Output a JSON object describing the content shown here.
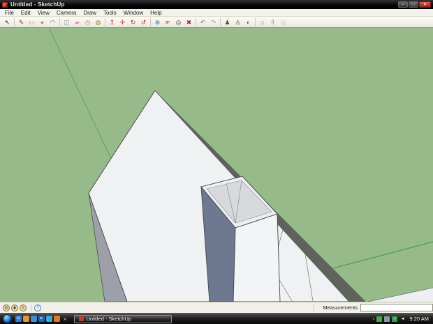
{
  "window": {
    "title": "Untitled - SketchUp",
    "controls": {
      "minimize": "–",
      "maximize": "▢",
      "close": "✕"
    }
  },
  "menu": {
    "items": [
      "File",
      "Edit",
      "View",
      "Camera",
      "Draw",
      "Tools",
      "Window",
      "Help"
    ]
  },
  "toolbar": {
    "groups": [
      [
        {
          "name": "select-tool",
          "glyph": "↖",
          "color": "#1a1a1a"
        }
      ],
      [
        {
          "name": "line-tool",
          "glyph": "✎",
          "color": "#a23228"
        },
        {
          "name": "rectangle-tool",
          "glyph": "▭",
          "color": "#a8905a"
        },
        {
          "name": "circle-tool",
          "glyph": "●",
          "color": "#b49a62"
        },
        {
          "name": "arc-tool",
          "glyph": "◠",
          "color": "#5a5a5a"
        }
      ],
      [
        {
          "name": "make-component-tool",
          "glyph": "◫",
          "color": "#9aa0a8"
        },
        {
          "name": "eraser-tool",
          "glyph": "▰",
          "color": "#d897ae"
        },
        {
          "name": "tape-measure-tool",
          "glyph": "◷",
          "color": "#a8895a"
        },
        {
          "name": "paint-bucket-tool",
          "glyph": "◍",
          "color": "#9a8d3a"
        }
      ],
      [
        {
          "name": "push-pull-tool",
          "glyph": "↥",
          "color": "#b0342a"
        },
        {
          "name": "move-tool",
          "glyph": "✛",
          "color": "#b0342a"
        },
        {
          "name": "rotate-tool",
          "glyph": "↻",
          "color": "#b0342a"
        },
        {
          "name": "offset-tool",
          "glyph": "↺",
          "color": "#b0342a"
        }
      ],
      [
        {
          "name": "orbit-tool",
          "glyph": "⊛",
          "color": "#2f6fb3"
        },
        {
          "name": "pan-tool",
          "glyph": "☛",
          "color": "#c79b5b"
        },
        {
          "name": "zoom-tool",
          "glyph": "◎",
          "color": "#44484e"
        },
        {
          "name": "zoom-extents-tool",
          "glyph": "✖",
          "color": "#8b3a3a"
        }
      ],
      [
        {
          "name": "previous-view",
          "glyph": "↶",
          "color": "#7a7d82"
        },
        {
          "name": "next-view",
          "glyph": "↷",
          "color": "#a0a3a8"
        }
      ],
      [
        {
          "name": "position-camera-tool",
          "glyph": "♟",
          "color": "#6b4f2a"
        },
        {
          "name": "walk-tool",
          "glyph": "♙",
          "color": "#4a6b3a"
        },
        {
          "name": "google-earth-button",
          "glyph": "◐",
          "color": "#2f6fb3"
        }
      ],
      [
        {
          "name": "get-models-button",
          "glyph": "⌂",
          "color": "#8a6d3f"
        },
        {
          "name": "share-model-button",
          "glyph": "⇧",
          "color": "#8a6d3f"
        },
        {
          "name": "photo-textures-button",
          "glyph": "▦",
          "color": "#b8b8b8",
          "disabled": true
        }
      ]
    ]
  },
  "colors": {
    "ground": "#96ba89",
    "axis_back": "#6f9a60",
    "axis_front": "#4aa04a",
    "roof": "#f0f1f3",
    "roof_side": "#9da0a8",
    "band": "#5e635b",
    "lower_wedge": "#edeff1",
    "tower_left": "#6e7890",
    "tower_right": "#f3f4f6",
    "rim": "#eceef1",
    "inside": "#d7d9dd",
    "outline": "#3f434a",
    "inner_line": "#8d9096",
    "detail_line": "#70736b"
  },
  "status_bar": {
    "icons": [
      {
        "name": "geolocation-status-icon",
        "glyph": "◍",
        "bg": "#ead9ac",
        "border": "#8a7040",
        "fg": "#6a4f26"
      },
      {
        "name": "credit-status-icon",
        "glyph": "♟",
        "bg": "#ead9ac",
        "border": "#8a7040",
        "fg": "#4a3416"
      },
      {
        "name": "signin-status-icon",
        "glyph": "♙",
        "bg": "#ead9ac",
        "border": "#8a7040",
        "fg": "#6a4f26"
      },
      {
        "name": "help-icon",
        "glyph": "?",
        "bg": "#eef4fc",
        "border": "#4a7fc0",
        "fg": "#2458a8",
        "sep": true
      }
    ],
    "measurements_label": "Measurements",
    "measurements_value": ""
  },
  "taskbar": {
    "quick_launch": [
      {
        "name": "ie-icon",
        "glyph": "e",
        "bg": "#2f7fd6"
      },
      {
        "name": "chrome-icon",
        "glyph": "",
        "bg": "#e2933c"
      },
      {
        "name": "messenger-icon",
        "glyph": "",
        "bg": "#3f8fd1"
      },
      {
        "name": "media-player-icon",
        "glyph": "▸",
        "bg": "#2468b0"
      },
      {
        "name": "msn-icon",
        "glyph": "",
        "bg": "#38a8e0"
      },
      {
        "name": "firefox-icon",
        "glyph": "",
        "bg": "#e8761e"
      }
    ],
    "overflow": "»",
    "task_button": "Untitled - SketchUp",
    "tray_chevron": "‹",
    "tray_icons": [
      {
        "name": "network-status-icon",
        "glyph": "",
        "bg": "#3fae49"
      },
      {
        "name": "update-status-icon",
        "glyph": "",
        "bg": "#8a97a5"
      },
      {
        "name": "security-status-icon",
        "glyph": "✓",
        "bg": "#2f9e44"
      },
      {
        "name": "volume-icon",
        "glyph": "◄",
        "bg": "transparent"
      }
    ],
    "clock": "9:20 AM"
  }
}
